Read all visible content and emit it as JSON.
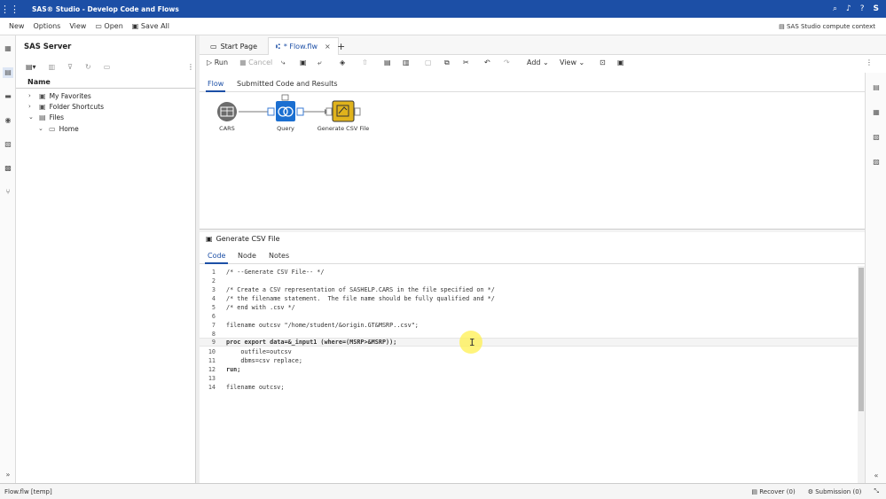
{
  "titlebar": {
    "title": "SAS® Studio - Develop Code and Flows",
    "user_initial": "S"
  },
  "menubar": {
    "items": [
      "New",
      "Options",
      "View",
      "Open",
      "Save All"
    ],
    "context": "SAS Studio compute context"
  },
  "sidebar": {
    "title": "SAS Server",
    "column_header": "Name",
    "tree": [
      {
        "label": "My Favorites"
      },
      {
        "label": "Folder Shortcuts"
      },
      {
        "label": "Files"
      },
      {
        "label": "Home"
      }
    ]
  },
  "tabs": [
    {
      "label": "Start Page"
    },
    {
      "label": "* Flow.flw"
    }
  ],
  "toolbar": {
    "run": "Run",
    "cancel": "Cancel",
    "add": "Add",
    "view": "View"
  },
  "subtabs": [
    "Flow",
    "Submitted Code and Results"
  ],
  "flow": {
    "nodes": [
      "CARS",
      "Query",
      "Generate CSV File"
    ]
  },
  "editor": {
    "title": "Generate CSV File",
    "tabs": [
      "Code",
      "Node",
      "Notes"
    ],
    "lines": [
      "/* --Generate CSV File-- */",
      "",
      "/* Create a CSV representation of SASHELP.CARS in the file specified on */",
      "/* the filename statement.  The file name should be fully qualified and */",
      "/* end with .csv */",
      "",
      "filename outcsv \"/home/student/&origin.GT&MSRP..csv\";",
      "",
      "proc export data=&_input1 (where=(MSRP>&MSRP));",
      "    outfile=outcsv",
      "    dbms=csv replace;",
      "run;",
      "",
      "filename outcsv;"
    ],
    "line_numbers": [
      "1",
      "2",
      "3",
      "4",
      "5",
      "6",
      "7",
      "8",
      "9",
      "10",
      "11",
      "12",
      "13",
      "14"
    ]
  },
  "statusbar": {
    "file": "Flow.flw [temp]",
    "recover": "Recover (0)",
    "submission": "Submission (0)"
  },
  "colors": {
    "brand": "#1c4fa6",
    "query_node": "#1b6fd1",
    "csv_node": "#e0b31c"
  }
}
